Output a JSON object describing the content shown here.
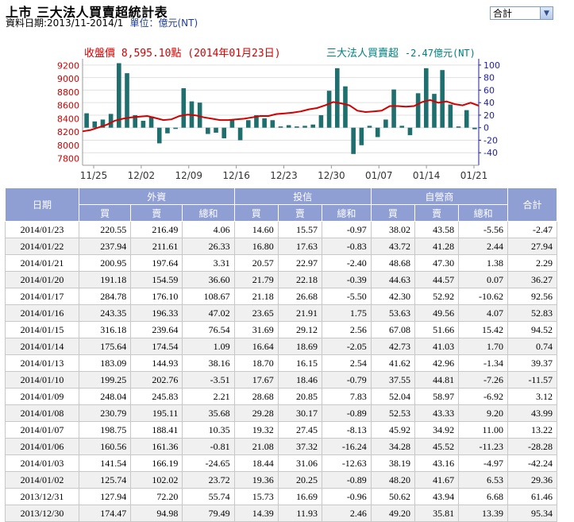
{
  "header": {
    "title": "上市 三大法人買賣超統計表",
    "date_range": "資料日期:2013/11-2014/1",
    "unit": "單位：億元(NT)"
  },
  "select": {
    "value": "合計",
    "options": [
      "合計"
    ]
  },
  "chart_header": {
    "left": "收盤價 8,595.10點 (2014年01月23日)",
    "right_label": "三大法人買賣超",
    "right_value": "-2.47億元(NT)"
  },
  "chart_data": {
    "type": "bar",
    "x_tick_labels": [
      "11/25",
      "12/02",
      "12/09",
      "12/16",
      "12/23",
      "12/30",
      "01/07",
      "01/14",
      "01/21"
    ],
    "left_axis": {
      "ticks": [
        7800,
        8000,
        8200,
        8400,
        8600,
        8800,
        9000,
        9200
      ],
      "ylim": [
        7700,
        9300
      ],
      "label": "收盤價"
    },
    "right_axis": {
      "ticks": [
        -40,
        -20,
        0,
        20,
        40,
        60,
        80,
        100
      ],
      "ylim": [
        -60,
        110
      ],
      "label": "三大法人買賣超"
    },
    "series": [
      {
        "name": "三大法人買賣超",
        "kind": "bar",
        "color": "#1f6f6f",
        "values": [
          23,
          10,
          13,
          22,
          103,
          87,
          20,
          11,
          18,
          -25,
          -9,
          -2,
          63,
          42,
          40,
          -10,
          -8,
          -17,
          12,
          -20,
          12,
          20,
          15,
          12,
          2,
          4,
          2,
          3,
          5,
          20,
          59,
          95,
          66,
          -42,
          -28,
          3,
          -15,
          13,
          61,
          3,
          -12,
          55,
          95,
          54,
          92,
          37,
          2,
          28,
          -2.47
        ]
      },
      {
        "name": "收盤價",
        "kind": "line",
        "color": "#d40000",
        "values": [
          8210,
          8230,
          8270,
          8310,
          8370,
          8400,
          8420,
          8430,
          8440,
          8410,
          8380,
          8390,
          8440,
          8460,
          8450,
          8420,
          8400,
          8380,
          8380,
          8390,
          8400,
          8420,
          8440,
          8440,
          8470,
          8480,
          8490,
          8510,
          8540,
          8560,
          8600,
          8650,
          8630,
          8600,
          8520,
          8500,
          8510,
          8520,
          8590,
          8590,
          8580,
          8590,
          8650,
          8680,
          8640,
          8660,
          8620,
          8600,
          8640,
          8595.1
        ]
      }
    ]
  },
  "table": {
    "headers": {
      "date": "日期",
      "foreign": "外資",
      "trust": "投信",
      "dealer": "自營商",
      "total": "合計",
      "buy": "買",
      "sell": "賣",
      "net": "總和"
    },
    "rows": [
      [
        "2014/01/23",
        "220.55",
        "216.49",
        "4.06",
        "14.60",
        "15.57",
        "-0.97",
        "38.02",
        "43.58",
        "-5.56",
        "-2.47"
      ],
      [
        "2014/01/22",
        "237.94",
        "211.61",
        "26.33",
        "16.80",
        "17.63",
        "-0.83",
        "43.72",
        "41.28",
        "2.44",
        "27.94"
      ],
      [
        "2014/01/21",
        "200.95",
        "197.64",
        "3.31",
        "20.57",
        "22.97",
        "-2.40",
        "48.68",
        "47.30",
        "1.38",
        "2.29"
      ],
      [
        "2014/01/20",
        "191.18",
        "154.59",
        "36.60",
        "21.79",
        "22.18",
        "-0.39",
        "44.63",
        "44.57",
        "0.07",
        "36.27"
      ],
      [
        "2014/01/17",
        "284.78",
        "176.10",
        "108.67",
        "21.18",
        "26.68",
        "-5.50",
        "42.30",
        "52.92",
        "-10.62",
        "92.56"
      ],
      [
        "2014/01/16",
        "243.35",
        "196.33",
        "47.02",
        "23.65",
        "21.91",
        "1.75",
        "53.63",
        "49.56",
        "4.07",
        "52.83"
      ],
      [
        "2014/01/15",
        "316.18",
        "239.64",
        "76.54",
        "31.69",
        "29.12",
        "2.56",
        "67.08",
        "51.66",
        "15.42",
        "94.52"
      ],
      [
        "2014/01/14",
        "175.64",
        "174.54",
        "1.09",
        "16.64",
        "18.69",
        "-2.05",
        "42.73",
        "41.03",
        "1.70",
        "0.74"
      ],
      [
        "2014/01/13",
        "183.09",
        "144.93",
        "38.16",
        "18.70",
        "16.15",
        "2.54",
        "41.62",
        "42.96",
        "-1.34",
        "39.37"
      ],
      [
        "2014/01/10",
        "199.25",
        "202.76",
        "-3.51",
        "17.67",
        "18.46",
        "-0.79",
        "37.55",
        "44.81",
        "-7.26",
        "-11.57"
      ],
      [
        "2014/01/09",
        "248.04",
        "245.83",
        "2.21",
        "28.68",
        "20.85",
        "7.83",
        "52.04",
        "58.97",
        "-6.92",
        "3.12"
      ],
      [
        "2014/01/08",
        "230.79",
        "195.11",
        "35.68",
        "29.28",
        "30.17",
        "-0.89",
        "52.53",
        "43.33",
        "9.20",
        "43.99"
      ],
      [
        "2014/01/07",
        "198.75",
        "188.41",
        "10.35",
        "19.32",
        "27.45",
        "-8.13",
        "45.92",
        "34.92",
        "11.00",
        "13.22"
      ],
      [
        "2014/01/06",
        "160.56",
        "161.36",
        "-0.81",
        "21.08",
        "37.32",
        "-16.24",
        "34.28",
        "45.52",
        "-11.23",
        "-28.28"
      ],
      [
        "2014/01/03",
        "141.54",
        "166.19",
        "-24.65",
        "18.44",
        "31.06",
        "-12.63",
        "38.19",
        "43.16",
        "-4.97",
        "-42.24"
      ],
      [
        "2014/01/02",
        "125.74",
        "102.02",
        "23.72",
        "19.36",
        "20.25",
        "-0.89",
        "48.20",
        "41.67",
        "6.53",
        "29.36"
      ],
      [
        "2013/12/31",
        "127.94",
        "72.20",
        "55.74",
        "15.73",
        "16.69",
        "-0.96",
        "50.62",
        "43.94",
        "6.68",
        "61.46"
      ],
      [
        "2013/12/30",
        "174.47",
        "94.98",
        "79.49",
        "14.39",
        "11.93",
        "2.46",
        "49.20",
        "35.81",
        "13.39",
        "95.34"
      ]
    ]
  }
}
